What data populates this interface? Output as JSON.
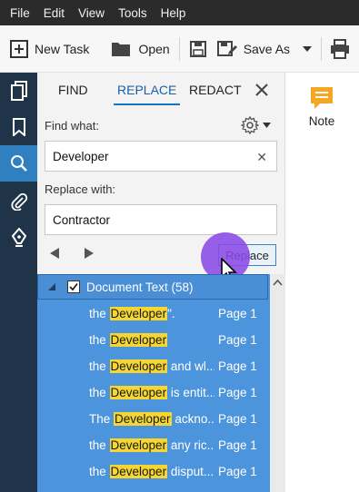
{
  "menu": [
    "File",
    "Edit",
    "View",
    "Tools",
    "Help"
  ],
  "toolbar": {
    "new_task": "New Task",
    "open": "Open",
    "save_as": "Save As"
  },
  "panel": {
    "tabs": [
      "FIND",
      "REPLACE",
      "REDACT"
    ],
    "active_tab": "REPLACE",
    "find_label": "Find what:",
    "find_value": "Developer",
    "replace_label": "Replace with:",
    "replace_value": "Contractor",
    "replace_button": "Replace"
  },
  "results": {
    "group_label": "Document Text (58)",
    "group_checked": true,
    "rows": [
      {
        "pre": "the ",
        "hl": "Developer",
        "post": "\".",
        "page": "Page 1"
      },
      {
        "pre": "the ",
        "hl": "Developer",
        "post": "",
        "page": "Page 1"
      },
      {
        "pre": "the ",
        "hl": "Developer",
        "post": " and wl...",
        "page": "Page 1"
      },
      {
        "pre": "the ",
        "hl": "Developer",
        "post": " is entit...",
        "page": "Page 1"
      },
      {
        "pre": "The ",
        "hl": "Developer",
        "post": " ackno...",
        "page": "Page 1"
      },
      {
        "pre": "the ",
        "hl": "Developer",
        "post": " any ric...",
        "page": "Page 1"
      },
      {
        "pre": "the ",
        "hl": "Developer",
        "post": " disput...",
        "page": "Page 1"
      }
    ]
  },
  "right_pane": {
    "note_label": "Note"
  },
  "colors": {
    "accent": "#1a73c8",
    "highlight": "#f5d632",
    "note_icon": "#f5a623",
    "rail": "#1f3448"
  }
}
